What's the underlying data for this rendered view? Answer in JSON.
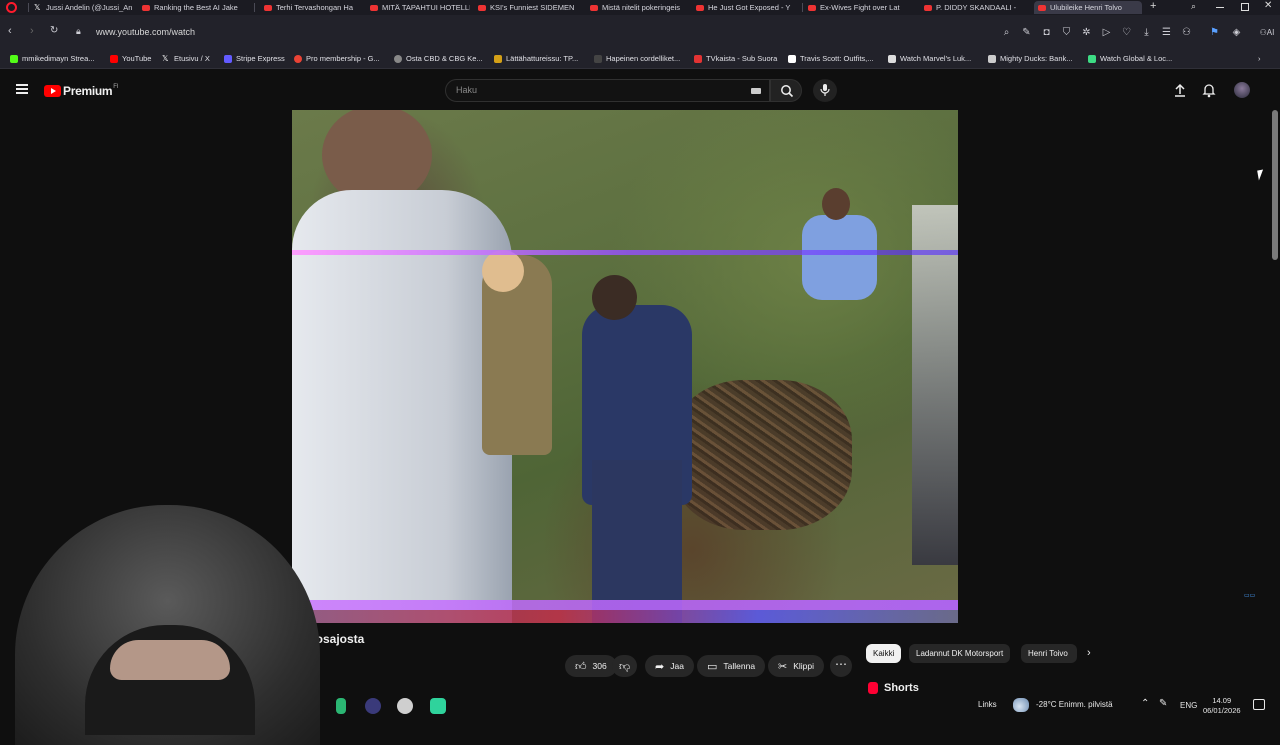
{
  "browser": {
    "tabs": [
      {
        "label": "Jussi Andelin (@Jussi_An",
        "icon": "x-logo"
      },
      {
        "label": "Ranking the Best AI Jake",
        "icon": "youtube-icon"
      },
      {
        "label": "Terhi Tervashongan Ha",
        "icon": "youtube-icon"
      },
      {
        "label": "MITÄ TAPAHTUI HOTELLI",
        "icon": "youtube-icon"
      },
      {
        "label": "KSI's Funniest SIDEMEN",
        "icon": "youtube-icon"
      },
      {
        "label": "Mistä nitelit pokeringeis",
        "icon": "youtube-icon"
      },
      {
        "label": "He Just Got Exposed - Y",
        "icon": "youtube-icon"
      },
      {
        "label": "Ex-Wives Fight over Lat",
        "icon": "youtube-icon"
      },
      {
        "label": "P. DIDDY SKANDAALI -",
        "icon": "youtube-icon"
      },
      {
        "label": "Ulubileike Henri Tolvo",
        "icon": "youtube-icon",
        "active": true
      }
    ],
    "url": "www.youtube.com/watch",
    "bookmarks": [
      {
        "label": "mmikedimayn Strea...",
        "color": "#53fc18"
      },
      {
        "label": "YouTube",
        "color": "#ff0000"
      },
      {
        "label": "Etusivu / X",
        "color": "#ffffff"
      },
      {
        "label": "Stripe Express",
        "color": "#635bff"
      },
      {
        "label": "Pro membership - G...",
        "color": "#ea4335"
      },
      {
        "label": "Osta CBD & CBG Ke...",
        "color": "#888888"
      },
      {
        "label": "Lättähattureissu: TP...",
        "color": "#d4a017"
      },
      {
        "label": "Hapeinen cordelliket...",
        "color": "#444444"
      },
      {
        "label": "TVkaista - Sub Suora",
        "color": "#e33333"
      },
      {
        "label": "Travis Scott: Outfits,...",
        "color": "#ffffff"
      },
      {
        "label": "Watch Marvel's Luk...",
        "color": "#dddddd"
      },
      {
        "label": "Mighty Ducks: Bank...",
        "color": "#cccccc"
      },
      {
        "label": "Watch Global & Loc...",
        "color": "#3ddc84"
      }
    ]
  },
  "youtube": {
    "logo_text": "Premium",
    "logo_sup": "FI",
    "search_placeholder": "Haku",
    "video_title": "ulosajosta",
    "likes": "306",
    "share_label": "Jaa",
    "save_label": "Tallenna",
    "clip_label": "Klippi",
    "chips": [
      "Kaikki",
      "Ladannut DK Motorsport",
      "Henri Toivo"
    ],
    "shorts_label": "Shorts"
  },
  "taskbar": {
    "links_label": "Links",
    "weather": "-28°C  Enimm. pilvistä",
    "lang": "ENG",
    "time": "14.09",
    "date": "06/01/2026"
  },
  "colors": {
    "youtube_red": "#ff0000",
    "background": "#0f0f0f",
    "chip_bg": "#272727"
  }
}
